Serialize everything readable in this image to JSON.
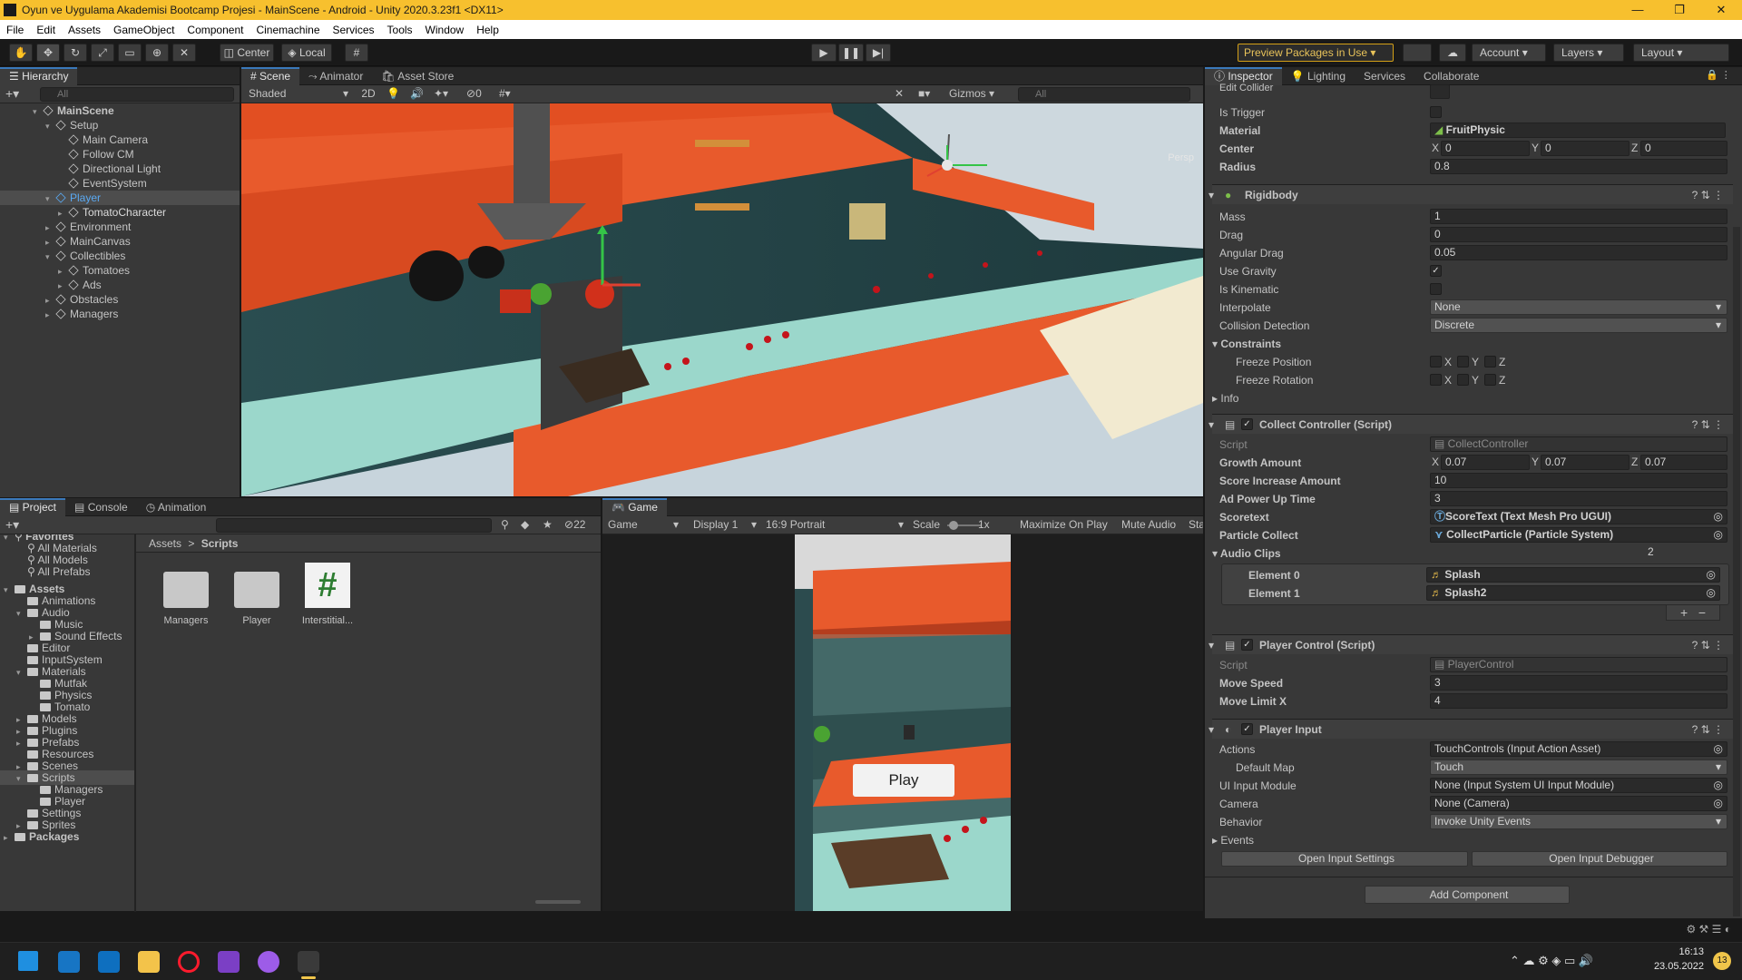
{
  "window": {
    "title": "Oyun ve Uygulama Akademisi Bootcamp Projesi - MainScene - Android - Unity 2020.3.23f1 <DX11>",
    "minimize": "—",
    "maximize": "❐",
    "close": "✕"
  },
  "menu": [
    "File",
    "Edit",
    "Assets",
    "GameObject",
    "Component",
    "Cinemachine",
    "Services",
    "Tools",
    "Window",
    "Help"
  ],
  "toolbar": {
    "center": "Center",
    "local": "Local",
    "preview_packages": "Preview Packages in Use ▾",
    "account": "Account",
    "layers": "Layers",
    "layout": "Layout"
  },
  "hierarchy": {
    "tab": "Hierarchy",
    "search_placeholder": "All",
    "items": [
      {
        "label": "MainScene",
        "depth": 0,
        "kind": "scene"
      },
      {
        "label": "Setup",
        "depth": 1
      },
      {
        "label": "Main Camera",
        "depth": 2
      },
      {
        "label": "Follow CM",
        "depth": 2
      },
      {
        "label": "Directional Light",
        "depth": 2
      },
      {
        "label": "EventSystem",
        "depth": 2
      },
      {
        "label": "Player",
        "depth": 1,
        "prefab": true
      },
      {
        "label": "TomatoCharacter",
        "depth": 2
      },
      {
        "label": "Environment",
        "depth": 1
      },
      {
        "label": "MainCanvas",
        "depth": 1
      },
      {
        "label": "Collectibles",
        "depth": 1
      },
      {
        "label": "Tomatoes",
        "depth": 2
      },
      {
        "label": "Ads",
        "depth": 2
      },
      {
        "label": "Obstacles",
        "depth": 1
      },
      {
        "label": "Managers",
        "depth": 1
      }
    ]
  },
  "scene": {
    "tabs": [
      "Scene",
      "Animator",
      "Asset Store"
    ],
    "shading": "Shaded",
    "mode_2d": "2D",
    "hidden_count": "0",
    "gizmos": "Gizmos",
    "search_placeholder": "All",
    "persp": "Persp"
  },
  "project": {
    "tabs": [
      "Project",
      "Console",
      "Animation"
    ],
    "hidden_count": "22",
    "favorites_header": "Favorites",
    "favorites": [
      "All Materials",
      "All Models",
      "All Prefabs"
    ],
    "assets_header": "Assets",
    "folders": [
      {
        "label": "Animations",
        "depth": 1
      },
      {
        "label": "Audio",
        "depth": 1
      },
      {
        "label": "Music",
        "depth": 2
      },
      {
        "label": "Sound Effects",
        "depth": 2
      },
      {
        "label": "Editor",
        "depth": 1
      },
      {
        "label": "InputSystem",
        "depth": 1
      },
      {
        "label": "Materials",
        "depth": 1
      },
      {
        "label": "Mutfak",
        "depth": 2
      },
      {
        "label": "Physics",
        "depth": 2
      },
      {
        "label": "Tomato",
        "depth": 2
      },
      {
        "label": "Models",
        "depth": 1
      },
      {
        "label": "Plugins",
        "depth": 1
      },
      {
        "label": "Prefabs",
        "depth": 1
      },
      {
        "label": "Resources",
        "depth": 1
      },
      {
        "label": "Scenes",
        "depth": 1
      },
      {
        "label": "Scripts",
        "depth": 1
      },
      {
        "label": "Managers",
        "depth": 2
      },
      {
        "label": "Player",
        "depth": 2
      },
      {
        "label": "Settings",
        "depth": 1
      },
      {
        "label": "Sprites",
        "depth": 1
      }
    ],
    "packages_header": "Packages",
    "breadcrumb": [
      "Assets",
      "Scripts"
    ],
    "grid_items": [
      {
        "label": "Managers",
        "type": "folder"
      },
      {
        "label": "Player",
        "type": "folder"
      },
      {
        "label": "Interstitial...",
        "type": "script"
      }
    ]
  },
  "game": {
    "tab": "Game",
    "display_mode": "Game",
    "display": "Display 1",
    "aspect": "16:9 Portrait",
    "scale_label": "Scale",
    "scale_value": "1x",
    "maximize": "Maximize On Play",
    "mute": "Mute Audio",
    "stats": "Sta",
    "play_button": "Play"
  },
  "inspector": {
    "tabs": [
      "Inspector",
      "Lighting",
      "Services",
      "Collaborate"
    ],
    "edit_collider": "Edit Collider",
    "sphere_collider": {
      "is_trigger": "Is Trigger",
      "material_label": "Material",
      "material_value": "FruitPhysic",
      "center_label": "Center",
      "center": {
        "x": "0",
        "y": "0",
        "z": "0"
      },
      "radius_label": "Radius",
      "radius": "0.8"
    },
    "rigidbody": {
      "title": "Rigidbody",
      "mass_label": "Mass",
      "mass": "1",
      "drag_label": "Drag",
      "drag": "0",
      "angular_drag_label": "Angular Drag",
      "angular_drag": "0.05",
      "use_gravity_label": "Use Gravity",
      "use_gravity": true,
      "is_kinematic_label": "Is Kinematic",
      "is_kinematic": false,
      "interpolate_label": "Interpolate",
      "interpolate": "None",
      "collision_label": "Collision Detection",
      "collision": "Discrete",
      "constraints": "Constraints",
      "freeze_position": "Freeze Position",
      "freeze_rotation": "Freeze Rotation",
      "info": "Info"
    },
    "collect_controller": {
      "title": "Collect Controller (Script)",
      "script_label": "Script",
      "script": "CollectController",
      "growth_label": "Growth Amount",
      "growth": {
        "x": "0.07",
        "y": "0.07",
        "z": "0.07"
      },
      "score_inc_label": "Score Increase Amount",
      "score_inc": "10",
      "ad_power_label": "Ad Power Up Time",
      "ad_power": "3",
      "scoretext_label": "Scoretext",
      "scoretext": "ScoreText (Text Mesh Pro UGUI)",
      "particle_label": "Particle Collect",
      "particle": "CollectParticle (Particle System)",
      "audio_label": "Audio Clips",
      "audio_count": "2",
      "elements": [
        {
          "label": "Element 0",
          "value": "Splash"
        },
        {
          "label": "Element 1",
          "value": "Splash2"
        }
      ],
      "add": "+",
      "remove": "−"
    },
    "player_control": {
      "title": "Player Control (Script)",
      "script_label": "Script",
      "script": "PlayerControl",
      "move_speed_label": "Move Speed",
      "move_speed": "3",
      "move_limit_label": "Move Limit X",
      "move_limit": "4"
    },
    "player_input": {
      "title": "Player Input",
      "actions_label": "Actions",
      "actions": "TouchControls (Input Action Asset)",
      "default_map_label": "Default Map",
      "default_map": "Touch",
      "ui_module_label": "UI Input Module",
      "ui_module": "None (Input System UI Input Module)",
      "camera_label": "Camera",
      "camera": "None (Camera)",
      "behavior_label": "Behavior",
      "behavior": "Invoke Unity Events",
      "events_label": "Events",
      "open_settings": "Open Input Settings",
      "open_debugger": "Open Input Debugger"
    },
    "add_component": "Add Component"
  },
  "taskbar": {
    "time": "16:13",
    "date": "23.05.2022",
    "notifications": "13"
  },
  "colors": {
    "accent": "#3a79bb",
    "titlebar": "#f7c02e",
    "cabinet": "#e85a2c",
    "counter": "#8fd1c4",
    "wall": "#2b4a4d"
  }
}
